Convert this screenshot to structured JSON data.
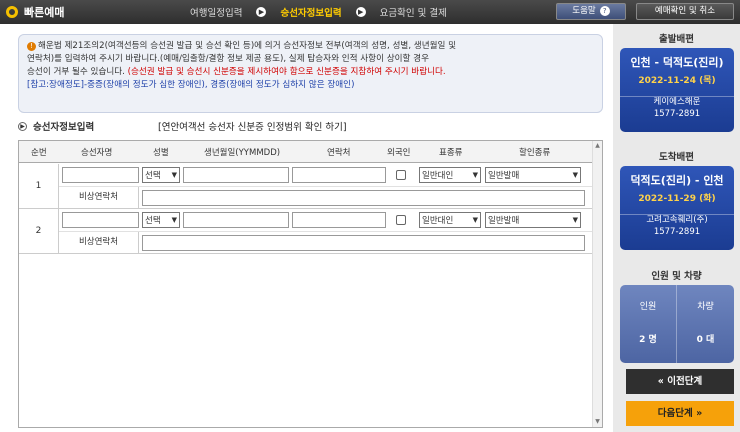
{
  "header": {
    "brand": "빠른예매",
    "steps": [
      "여행일정입력",
      "승선자정보입력",
      "요금확인 및 결제"
    ],
    "active_step": 1,
    "help_label": "도움말",
    "help_icon": "?",
    "reservation_label": "예매확인 및 취소"
  },
  "notice": {
    "line1": "해운법 제21조의2(여객선등의 승선권 발급 및 승선 확인 등)에 의거 승선자정보 전부(여객의 성명, 성별, 생년월일 및",
    "line2": "연락처)를 입력하여 주시기 바랍니다.(예매/입출항/결항 정보 제공 용도), 실제 탑승자와 인적 사항이 상이할 경우",
    "line3_black": "승선이 거부 될수 있습니다.",
    "line3_red": "(승선권 발급 및 승선시 신분증을 제시하여야 함으로 신분증을 지참하여 주시기 바랍니다.",
    "line4": "[참고:장애정도]-중증(장애의 정도가 심한 장애인), 경증(장애의 정도가 심하지 않은 장애인)"
  },
  "section": {
    "title": "승선자정보입력",
    "cert_link": "[연안여객선 승선자 신분증 인정범위 확인 하기]"
  },
  "table": {
    "headers": [
      "순번",
      "승선자명",
      "성별",
      "생년월일(YYMMDD)",
      "연락처",
      "외국인",
      "표종류",
      "할인종류"
    ],
    "emergency_label": "비상연락처",
    "rows": [
      {
        "num": "1",
        "gender": "선택",
        "ticket": "일반대인",
        "discount": "일반발매"
      },
      {
        "num": "2",
        "gender": "선택",
        "ticket": "일반대인",
        "discount": "일반발매"
      }
    ]
  },
  "sidebar": {
    "departure_title": "출발배편",
    "departure": {
      "route": "인천 - 덕적도(진리)",
      "date": "2022-11-24 (목)",
      "company": "케이에스해운",
      "phone": "1577-2891"
    },
    "arrival_title": "도착배편",
    "arrival": {
      "route": "덕적도(진리) - 인천",
      "date": "2022-11-29 (화)",
      "company": "고려고속훼리(주)",
      "phone": "1577-2891"
    },
    "count_title": "인원 및 차량",
    "persons_label": "인원",
    "persons_value": "2 명",
    "vehicles_label": "차량",
    "vehicles_value": "0 대",
    "prev_label": "이전단계",
    "next_label": "다음단계"
  }
}
